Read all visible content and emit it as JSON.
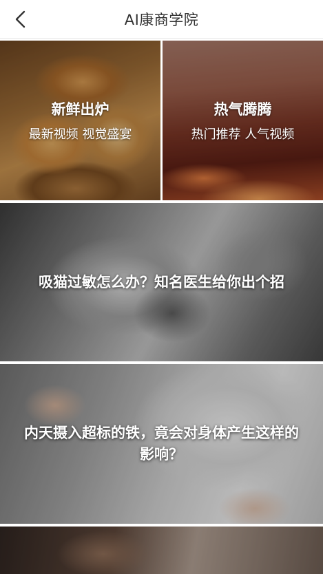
{
  "header": {
    "title": "AI康商学院",
    "back_icon": "chevron-left-icon"
  },
  "top_tiles": [
    {
      "title": "新鲜出炉",
      "subtitle": "最新视频 视觉盛宴"
    },
    {
      "title": "热气腾腾",
      "subtitle": "热门推荐  人气视频"
    }
  ],
  "articles": [
    {
      "title": "吸猫过敏怎么办？知名医生给你出个招"
    },
    {
      "title": "内天摄入超标的铁，竟会对身体产生这样的影响？"
    },
    {
      "title": ""
    }
  ]
}
